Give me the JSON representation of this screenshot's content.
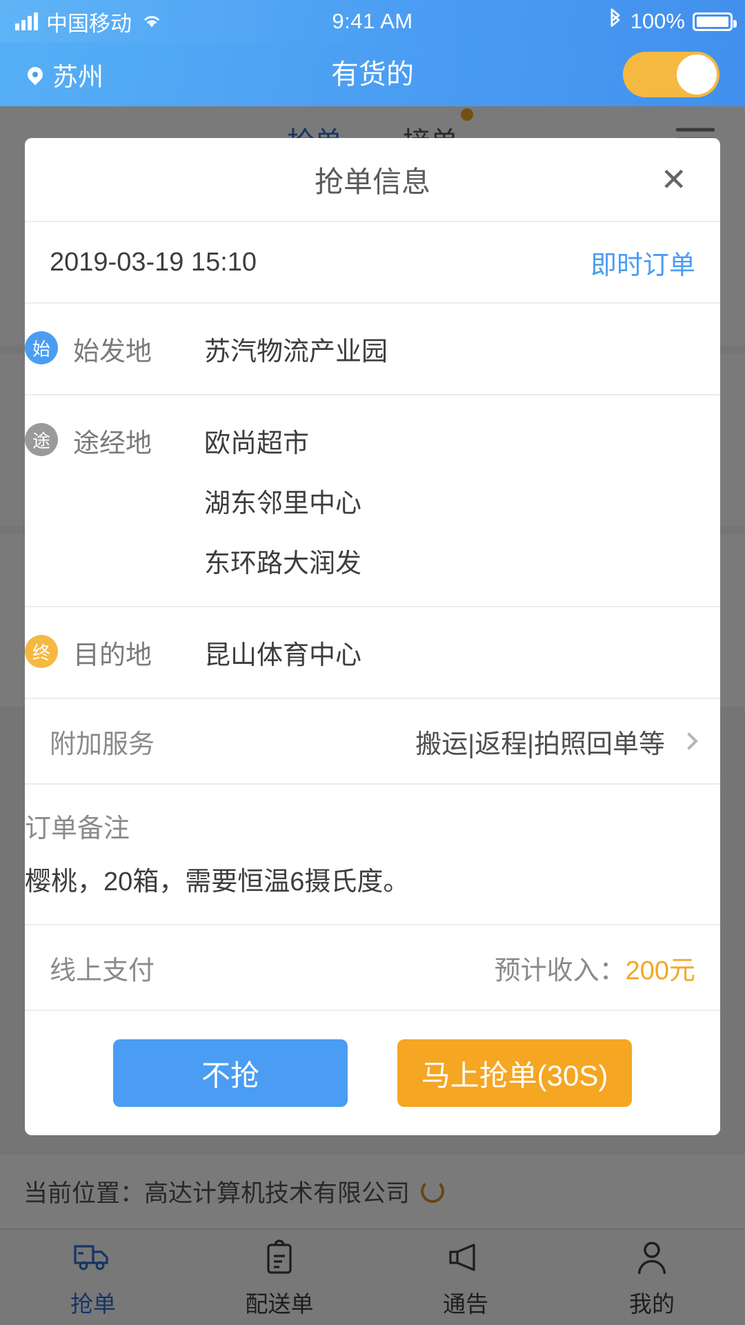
{
  "status_bar": {
    "carrier": "中国移动",
    "time": "9:41 AM",
    "battery_percent": "100%",
    "signal_icon": "signal-bars-icon",
    "wifi_icon": "wifi-icon",
    "bluetooth_icon": "bluetooth-icon",
    "battery_icon": "battery-full-icon"
  },
  "app_bar": {
    "city": "苏州",
    "title": "有货的",
    "location_icon": "map-pin-icon",
    "toggle_on": true,
    "toggle_color": "#f5b942"
  },
  "tab_strip": {
    "tabs": [
      {
        "label": "抢单",
        "active": true,
        "dot": false
      },
      {
        "label": "接单",
        "active": false,
        "dot": true
      }
    ],
    "menu_icon": "list-menu-icon"
  },
  "modal": {
    "title": "抢单信息",
    "close_icon": "close-icon",
    "order_time": "2019-03-19 15:10",
    "order_type": "即时订单",
    "order_type_color": "#4a9df2",
    "origin": {
      "chip": "始",
      "chip_color": "#4a9df2",
      "label": "始发地",
      "values": [
        "苏汽物流产业园"
      ]
    },
    "waypoints": {
      "chip": "途",
      "chip_color": "#9a9a9a",
      "label": "途经地",
      "values": [
        "欧尚超市",
        "湖东邻里中心",
        "东环路大润发"
      ]
    },
    "destination": {
      "chip": "终",
      "chip_color": "#f5b942",
      "label": "目的地",
      "values": [
        "昆山体育中心"
      ]
    },
    "extra_services": {
      "label": "附加服务",
      "value": "搬运|返程|拍照回单等",
      "chevron_icon": "chevron-right-icon"
    },
    "note": {
      "label": "订单备注",
      "text": "樱桃，20箱，需要恒温6摄氏度。"
    },
    "payment": {
      "method": "线上支付",
      "income_label": "预计收入：",
      "income_value": "200元",
      "income_color": "#f5a623"
    },
    "decline_button": "不抢",
    "accept_button": "马上抢单(30S)",
    "decline_color": "#4a9df2",
    "accept_color": "#f5a623"
  },
  "location_bar": {
    "text": "当前位置：高达计算机技术有限公司",
    "refresh_icon": "refresh-icon"
  },
  "bottom_nav": {
    "items": [
      {
        "label": "抢单",
        "icon": "truck-icon",
        "active": true
      },
      {
        "label": "配送单",
        "icon": "clipboard-icon",
        "active": false
      },
      {
        "label": "通告",
        "icon": "megaphone-icon",
        "active": false
      },
      {
        "label": "我的",
        "icon": "user-icon",
        "active": false
      }
    ]
  }
}
